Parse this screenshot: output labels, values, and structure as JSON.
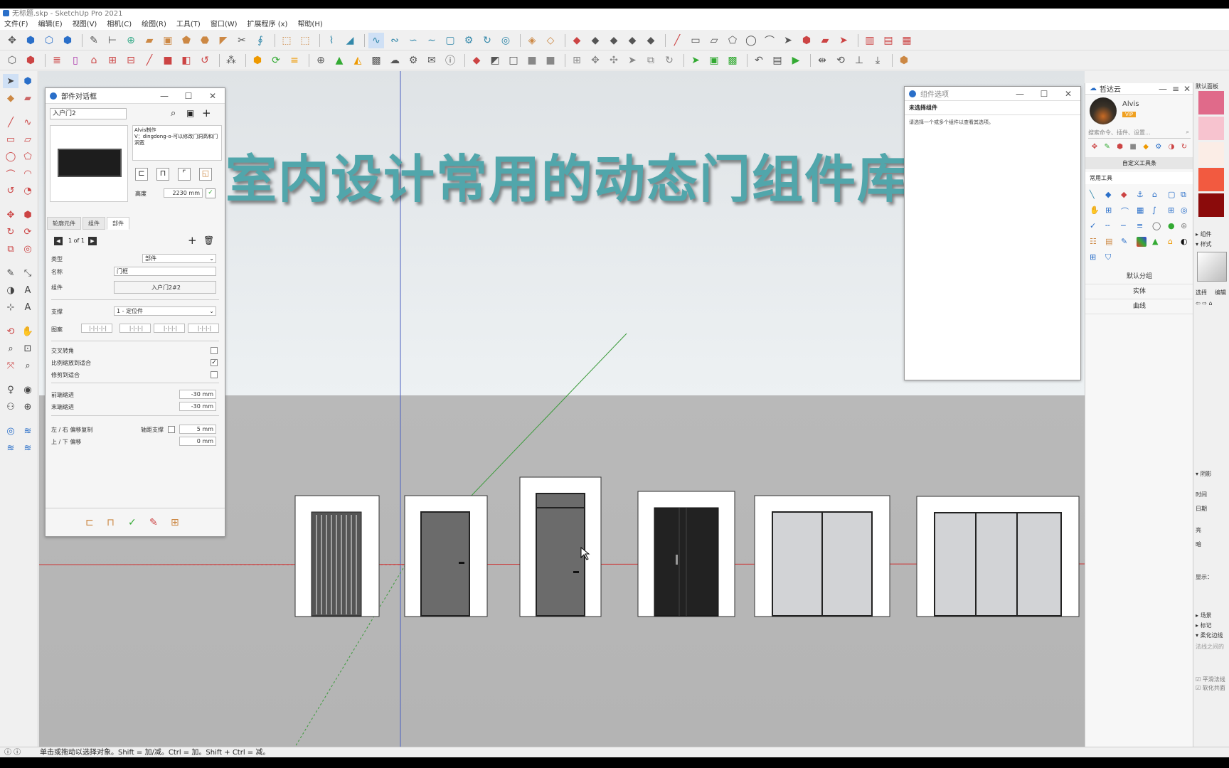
{
  "app": {
    "window_title": "无标题.skp - SketchUp Pro 2021",
    "menu": [
      "文件(F)",
      "编辑(E)",
      "视图(V)",
      "相机(C)",
      "绘图(R)",
      "工具(T)",
      "窗口(W)",
      "扩展程序 (x)",
      "帮助(H)"
    ],
    "status_text": "单击或拖动以选择对象。Shift = 加/减。Ctrl = 加。Shift + Ctrl = 减。"
  },
  "overlay": {
    "title": "室内设计常用的动态门组件库"
  },
  "component_dialog": {
    "title": "部件对话框",
    "search_value": "入户门2",
    "desc_line1": "Alvis制作",
    "desc_line2": "V：dingdong-o-可以修改门洞高和门洞宽",
    "height_label": "高度",
    "height_value": "2230 mm",
    "tabs": [
      "轮廓元件",
      "组件",
      "部件"
    ],
    "pager": "1 of 1",
    "type_label": "类型",
    "type_value": "部件",
    "name_label": "名称",
    "name_value": "门框",
    "component_label": "组件",
    "component_value": "入户门2#2",
    "support_label": "支撑",
    "support_value": "1 - 定位件",
    "pattern_label": "图案",
    "patterns": [
      "|-|-|-|-|",
      "|-|-|-|",
      "|-|-|-|",
      "|-|-|-|"
    ],
    "cross_label": "交叉转角",
    "scale_label": "比例缩放到适合",
    "trim_label": "修剪到适合",
    "front_label": "前端缩进",
    "front_value": "-30 mm",
    "back_label": "末端缩进",
    "back_value": "-30 mm",
    "lr_label": "左 / 右 偏移复制",
    "lr_label2": "轴距支撑",
    "lr_value": "5 mm",
    "ud_label": "上 / 下 偏移",
    "ud_value": "0 mm"
  },
  "info_panel": {
    "title": "组件选项",
    "heading": "未选择组件",
    "message": "请选择一个或多个组件以查看其选项。"
  },
  "zhidayun": {
    "title": "哲达云",
    "user_name": "Alvis",
    "badge": "VIP",
    "search_placeholder": "搜索命令、插件、设置...",
    "custom_toolbar": "自定义工具条",
    "common_tools": "常用工具",
    "list": [
      "默认分组",
      "实体",
      "曲线"
    ]
  },
  "right_panel": {
    "title": "默认面板",
    "sections": [
      "组件",
      "样式",
      "阴影",
      "场景",
      "标记",
      "柔化边线"
    ],
    "select_label": "选择",
    "edit_label": "编辑",
    "time_label": "时间",
    "date_label": "日期",
    "light_label": "亮",
    "dark_label": "暗",
    "show_label": "显示：",
    "normal_label": "法线之间的",
    "smooth_label": "平滑法线",
    "soften_label": "软化共面"
  },
  "colors": {
    "accent": "#2a6fc9",
    "overlay_text": "#51a6ab",
    "axis_red": "#cc3333",
    "axis_green": "#3a9a3a",
    "axis_blue": "#4a5fc0"
  }
}
